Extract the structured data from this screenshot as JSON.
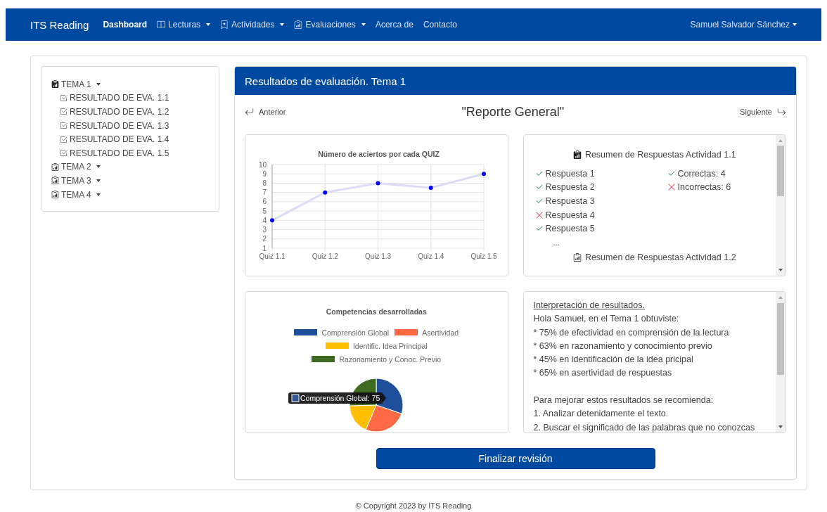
{
  "navbar": {
    "brand": "ITS Reading",
    "items": [
      {
        "label": "Dashboard",
        "selected": true,
        "dropdown": false
      },
      {
        "label": "Lecturas",
        "selected": false,
        "dropdown": true
      },
      {
        "label": "Actividades",
        "selected": false,
        "dropdown": true
      },
      {
        "label": "Evaluaciones",
        "selected": false,
        "dropdown": true
      },
      {
        "label": "Acerca de",
        "selected": false,
        "dropdown": false
      },
      {
        "label": "Contacto",
        "selected": false,
        "dropdown": false
      }
    ],
    "user": "Samuel Salvador Sánchez"
  },
  "sidebar": {
    "items": [
      {
        "label": "TEMA 1",
        "expanded": true,
        "children": [
          {
            "label": "RESULTADO DE EVA. 1.1"
          },
          {
            "label": "RESULTADO DE EVA. 1.2"
          },
          {
            "label": "RESULTADO DE EVA. 1.3"
          },
          {
            "label": "RESULTADO DE EVA. 1.4"
          },
          {
            "label": "RESULTADO DE EVA. 1.5"
          }
        ]
      },
      {
        "label": "TEMA 2",
        "expanded": false
      },
      {
        "label": "TEMA 3",
        "expanded": false
      },
      {
        "label": "TEMA 4",
        "expanded": false
      }
    ]
  },
  "panel": {
    "title": "Resultados de evaluación. Tema 1",
    "previous": "Anterior",
    "heading": "\"Reporte General\"",
    "next": "Siguiente",
    "line_chart": {
      "chart_data": {
        "type": "line",
        "title": "Número de aciertos por cada QUIZ",
        "categories": [
          "Quiz 1.1",
          "Quiz 1.2",
          "Quiz 1.3",
          "Quiz 1.4",
          "Quiz 1.5"
        ],
        "series": [
          {
            "color": "#0000ff",
            "marker": "circle",
            "values": [
              4,
              7,
              8,
              7.5,
              9
            ]
          }
        ],
        "grid": true,
        "ylim": [
          1,
          10
        ],
        "yticks": [
          1,
          2,
          3,
          4,
          5,
          6,
          7,
          8,
          9,
          10
        ]
      }
    },
    "answers": {
      "heading": "Resumen de Respuestas Actividad 1.1",
      "items": [
        {
          "label": "Respuesta 1",
          "correct": true
        },
        {
          "label": "Respuesta 2",
          "correct": true
        },
        {
          "label": "Respuesta 3",
          "correct": true
        },
        {
          "label": "Respuesta 4",
          "correct": false
        },
        {
          "label": "Respuesta 5",
          "correct": true
        }
      ],
      "totals": [
        {
          "label": "Correctas: 4",
          "correct": true
        },
        {
          "label": "Incorrectas: 6",
          "correct": false
        }
      ],
      "more": "...",
      "next_heading": "Resumen de Respuestas Actividad 1.2"
    },
    "pie_chart": {
      "chart_data": {
        "type": "pie",
        "title": "Competencias desarrolladas",
        "categories": [
          "Comprensión Global",
          "Asertividad",
          "Identific. Idea Principal",
          "Razonamiento y Conoc. Previo"
        ],
        "values": [
          30.2,
          26.2,
          18.2,
          25.4
        ],
        "legend": true,
        "colors": [
          "#1f4e9a",
          "#ff6a45",
          "#ffbf00",
          "#3e6b1f"
        ]
      },
      "tooltip": {
        "text": "Comprensión Global: 75",
        "color": "#2f5597"
      }
    },
    "interpretation": {
      "title": "Interpretación de resultados.",
      "lines": [
        "Hola Samuel, en el Tema 1 obtuviste:",
        "* 75% de efectividad en comprensión de la lectura",
        "* 63% en razonamiento y conocimiento previo",
        "* 45% en identificación de la idea pricipal",
        "* 65% en asertividad de respuestas"
      ],
      "lines_2": [
        "Para mejorar estos resultados se recomienda:",
        "1. Analizar detenidamente el texto.",
        "2. Buscar el significado de las palabras que no conozcas"
      ]
    },
    "finish_button": "Finalizar revisión"
  },
  "footer": "© Copyright 2023 by ITS Reading"
}
